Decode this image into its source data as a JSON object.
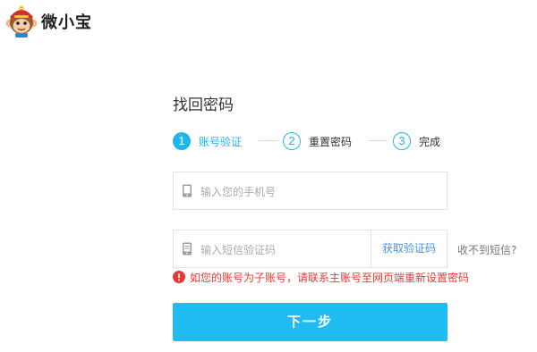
{
  "header": {
    "app_name": "微小宝"
  },
  "page": {
    "title": "找回密码"
  },
  "steps": [
    {
      "number": "1",
      "label": "账号验证",
      "active": true
    },
    {
      "number": "2",
      "label": "重置密码",
      "active": false
    },
    {
      "number": "3",
      "label": "完成",
      "active": false
    }
  ],
  "form": {
    "phone": {
      "placeholder": "输入您的手机号",
      "icon": "mobile-phone-icon"
    },
    "sms_code": {
      "placeholder": "输入短信验证码",
      "icon": "sms-phone-icon"
    },
    "get_code_label": "获取验证码",
    "help_link": "收不到短信?",
    "error_message": "如您的账号为子账号，请联系主账号至网页端重新设置密码",
    "submit_label": "下一步"
  },
  "colors": {
    "accent": "#21b6e8",
    "button": "#1ebcf0",
    "error": "#e53935",
    "link": "#4a90d9"
  }
}
